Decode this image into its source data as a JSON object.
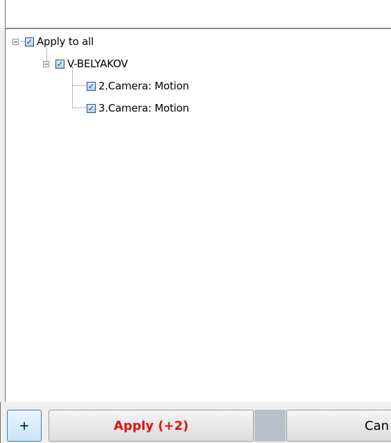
{
  "tree": {
    "root_label": "Apply to all",
    "computer_label": "V-BELYAKOV",
    "items": [
      {
        "label": "2.Camera: Motion"
      },
      {
        "label": "3.Camera: Motion"
      }
    ]
  },
  "footer": {
    "add_label": "+",
    "apply_label": "Apply (+2)",
    "cancel_label": "Can"
  },
  "colors": {
    "apply_text": "#e01010"
  }
}
